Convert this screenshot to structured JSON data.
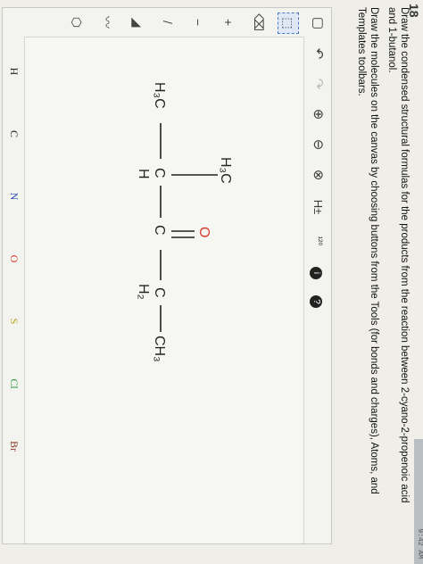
{
  "question": {
    "number": "18",
    "instructions": [
      "Draw the condensed structural formulas for the products from the reaction between 2-cyano-2-propenoic acid and 1-butanol.",
      "Draw the molecules on the canvas by choosing buttons from the Tools (for bonds and charges), Atoms, and Templates toolbars."
    ]
  },
  "browser": {
    "clock": "9:42 AM"
  },
  "toolbar_top": [
    {
      "name": "new-doc-icon",
      "glyph": "▢"
    },
    {
      "name": "undo-icon",
      "glyph": "↶"
    },
    {
      "name": "redo-icon",
      "glyph": "↷"
    },
    {
      "name": "zoom-in-icon",
      "glyph": "⊕"
    },
    {
      "name": "zoom-out-icon",
      "glyph": "⊖"
    },
    {
      "name": "clear-icon",
      "glyph": "⊗"
    },
    {
      "name": "explicit-h-icon",
      "glyph": "H±"
    },
    {
      "name": "numbering-icon",
      "glyph": "¹²⁰"
    },
    {
      "name": "info-icon",
      "glyph": "i"
    },
    {
      "name": "help-icon",
      "glyph": "?"
    }
  ],
  "toolbar_left": [
    {
      "name": "select-tool-icon",
      "glyph": "⬚"
    },
    {
      "name": "eraser-icon",
      "glyph": "⌫"
    },
    {
      "name": "charge-plus-icon",
      "glyph": "+"
    },
    {
      "name": "charge-minus-icon",
      "glyph": "−"
    },
    {
      "name": "single-bond-icon",
      "glyph": "/"
    },
    {
      "name": "wedge-bond-icon",
      "glyph": "◢"
    },
    {
      "name": "chain-tool-icon",
      "glyph": "〰"
    },
    {
      "name": "ring-template-icon",
      "glyph": "⬡"
    }
  ],
  "atoms": [
    {
      "symbol": "H",
      "color": "#222222"
    },
    {
      "symbol": "C",
      "color": "#222222"
    },
    {
      "symbol": "N",
      "color": "#2b4fb3"
    },
    {
      "symbol": "O",
      "color": "#d23b2b"
    },
    {
      "symbol": "S",
      "color": "#b8a21d"
    },
    {
      "symbol": "Cl",
      "color": "#2e9a3a"
    },
    {
      "symbol": "Br",
      "color": "#8a3b24"
    }
  ],
  "molecule": {
    "left_methyl": "H₃C",
    "top_methyl": "H₃C",
    "alpha_carbon": "C",
    "alpha_h": "H",
    "carbonyl_c": "C",
    "carbonyl_o": "O",
    "ch2_c": "C",
    "ch2_h": "H₂",
    "terminal": "CH₃"
  }
}
